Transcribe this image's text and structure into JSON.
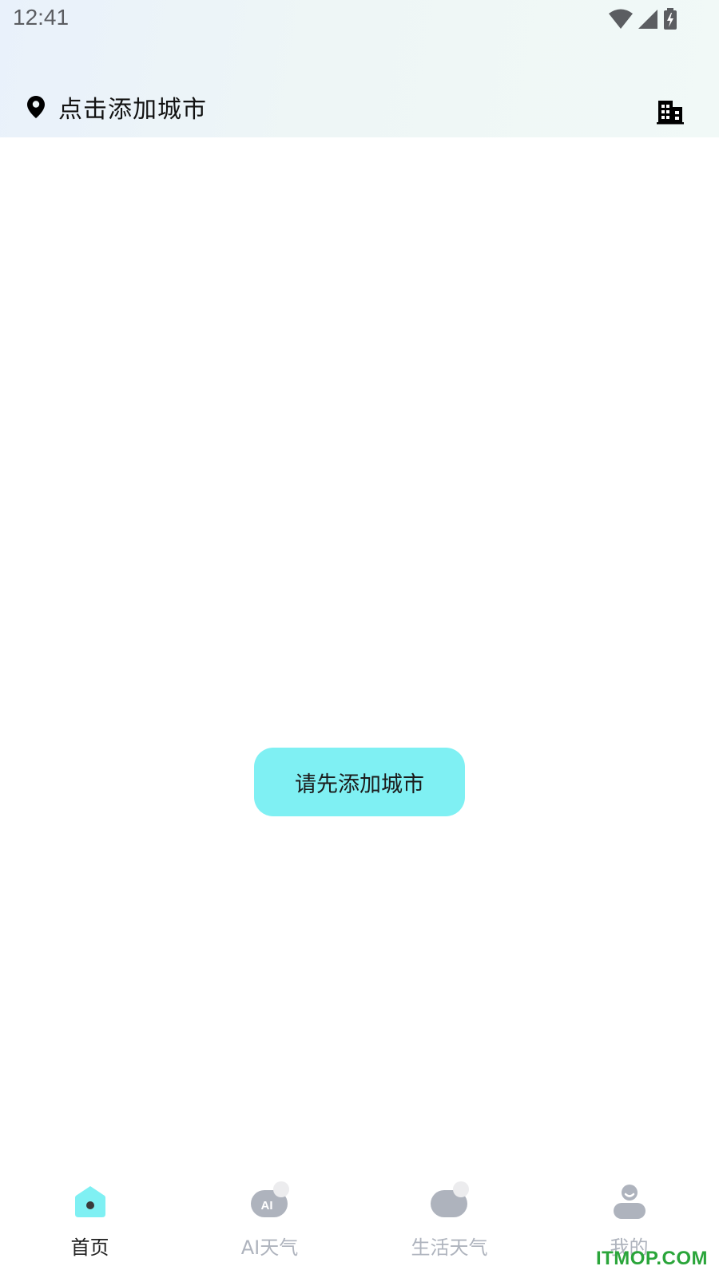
{
  "status_bar": {
    "time": "12:41",
    "icons": [
      "wifi-icon",
      "cell-signal-icon",
      "battery-charging-icon"
    ]
  },
  "header": {
    "location_icon": "map-pin-icon",
    "location_text": "点击添加城市",
    "city_manage_icon": "buildings-icon"
  },
  "main": {
    "add_city_button_label": "请先添加城市",
    "button_color": "#7ff0f3"
  },
  "bottom_nav": {
    "items": [
      {
        "label": "首页",
        "icon": "home-icon",
        "active": true
      },
      {
        "label": "AI天气",
        "icon": "ai-cloud-icon",
        "active": false
      },
      {
        "label": "生活天气",
        "icon": "cloud-sun-icon",
        "active": false
      },
      {
        "label": "我的",
        "icon": "person-icon",
        "active": false
      }
    ],
    "active_color": "#7ff0f3",
    "inactive_color": "#aeb3bd"
  },
  "watermark": "ITMOP.COM"
}
